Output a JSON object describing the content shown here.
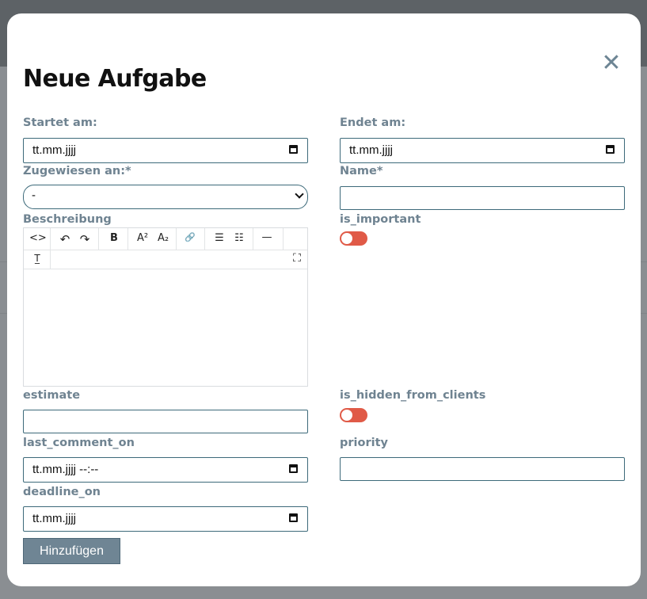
{
  "modal": {
    "title": "Neue Aufgabe",
    "close_glyph": "✕",
    "submit_label": "Hinzufügen"
  },
  "fields": {
    "starts_on": {
      "label": "Startet am:",
      "value": "tt.mm.jjjj"
    },
    "ends_on": {
      "label": "Endet am:",
      "value": "tt.mm.jjjj"
    },
    "assigned_to": {
      "label": "Zugewiesen an:*",
      "selected": "-"
    },
    "name": {
      "label": "Name*",
      "value": ""
    },
    "description": {
      "label": "Beschreibung"
    },
    "is_important": {
      "label": "is_important",
      "on": false
    },
    "estimate": {
      "label": "estimate",
      "value": ""
    },
    "is_hidden_from_clients": {
      "label": "is_hidden_from_clients",
      "on": false
    },
    "last_comment_on": {
      "label": "last_comment_on",
      "value": "tt.mm.jjjj --:--"
    },
    "priority": {
      "label": "priority",
      "value": ""
    },
    "deadline_on": {
      "label": "deadline_on",
      "value": "tt.mm.jjjj"
    }
  },
  "editor_toolbar": {
    "source": "<>",
    "undo": "↶",
    "redo": "↷",
    "bold": "B",
    "superscript": "A²",
    "subscript": "A₂",
    "link": "🔗",
    "bullet_list": "☰",
    "numbered_list": "☷",
    "horizontal_rule": "—",
    "clear_format": "T̲",
    "fullscreen": "⛶"
  },
  "colors": {
    "label": "#6f8391",
    "border": "#3d6a7a",
    "toggle_off": "#e05a47",
    "button": "#6f8594"
  }
}
